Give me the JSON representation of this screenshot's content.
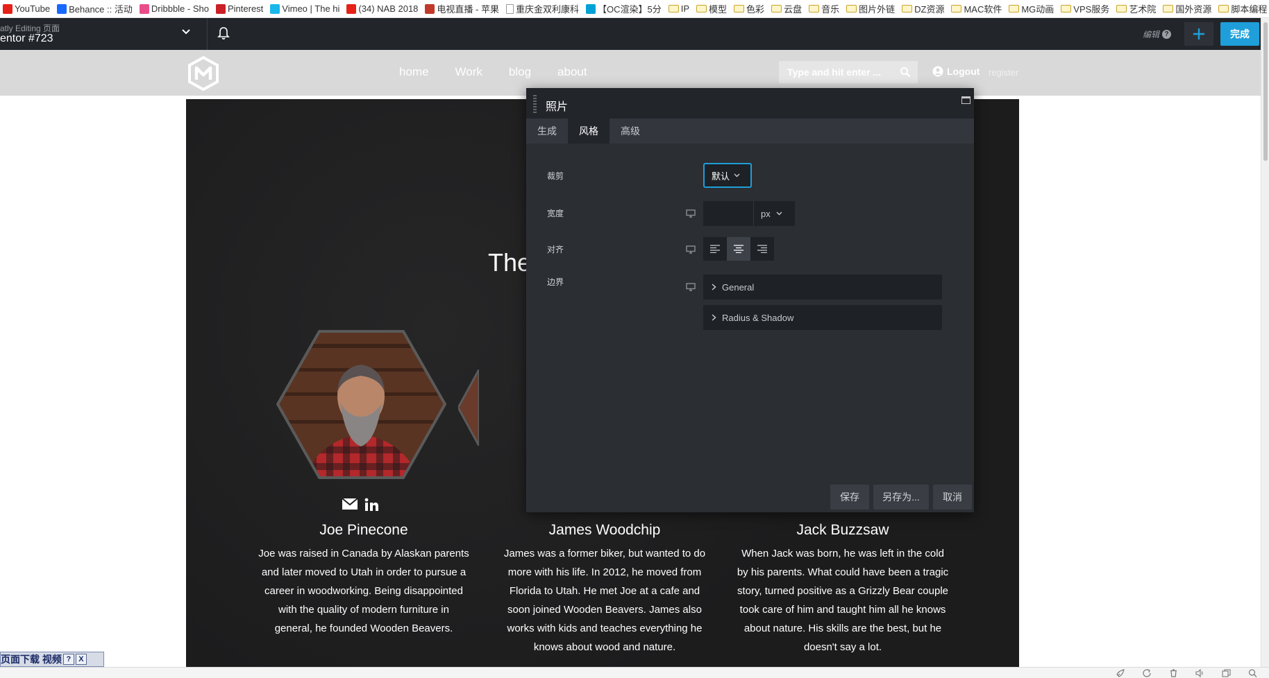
{
  "bookmarks": [
    {
      "label": "YouTube",
      "icon": "youtube-icon",
      "color": "#e62117"
    },
    {
      "label": "Behance :: 活动",
      "icon": "behance-icon",
      "color": "#1769ff"
    },
    {
      "label": "Dribbble - Sho",
      "icon": "dribbble-icon",
      "color": "#ea4c89"
    },
    {
      "label": "Pinterest",
      "icon": "pinterest-icon",
      "color": "#cb2027"
    },
    {
      "label": "Vimeo | The hi",
      "icon": "vimeo-icon",
      "color": "#1ab7ea"
    },
    {
      "label": "(34) NAB 2018",
      "icon": "youtube-icon",
      "color": "#e62117"
    },
    {
      "label": "电视直播 - 苹果",
      "icon": "tv-icon",
      "color": "#c0392b"
    },
    {
      "label": "重庆金双利康科",
      "icon": "page-icon",
      "color": "#999999"
    },
    {
      "label": "【OC渲染】5分",
      "icon": "bilibili-icon",
      "color": "#00a1d6"
    },
    {
      "label": "IP",
      "icon": "folder-icon",
      "color": "#c9a227"
    },
    {
      "label": "模型",
      "icon": "folder-icon",
      "color": "#c9a227"
    },
    {
      "label": "色彩",
      "icon": "folder-icon",
      "color": "#c9a227"
    },
    {
      "label": "云盘",
      "icon": "folder-icon",
      "color": "#c9a227"
    },
    {
      "label": "音乐",
      "icon": "folder-icon",
      "color": "#c9a227"
    },
    {
      "label": "图片外链",
      "icon": "folder-icon",
      "color": "#c9a227"
    },
    {
      "label": "DZ资源",
      "icon": "folder-icon",
      "color": "#c9a227"
    },
    {
      "label": "MAC软件",
      "icon": "folder-icon",
      "color": "#c9a227"
    },
    {
      "label": "MG动画",
      "icon": "folder-icon",
      "color": "#c9a227"
    },
    {
      "label": "VPS服务",
      "icon": "folder-icon",
      "color": "#c9a227"
    },
    {
      "label": "艺术院",
      "icon": "folder-icon",
      "color": "#c9a227"
    },
    {
      "label": "国外资源",
      "icon": "folder-icon",
      "color": "#c9a227"
    },
    {
      "label": "脚本编程",
      "icon": "folder-icon",
      "color": "#c9a227"
    }
  ],
  "bookmarks_more": "»",
  "topbar": {
    "subtitle": "atly Editing 页面",
    "title": "entor #723",
    "edit_label": "编辑",
    "help_glyph": "?",
    "done_label": "完成",
    "accent": "#1e9fd9"
  },
  "site": {
    "nav": [
      "home",
      "Work",
      "blog",
      "about"
    ],
    "search_placeholder": "Type and hit enter ...",
    "logout_label": "Logout",
    "register_label": "register"
  },
  "content": {
    "headline": "The",
    "team": [
      {
        "name": "Joe Pinecone",
        "bio": [
          "Joe was raised in Canada by Alaskan parents",
          "and later moved to Utah in order to pursue a",
          "career in woodworking. Being disappointed",
          "with the quality of modern furniture in",
          "general, he founded Wooden Beavers."
        ]
      },
      {
        "name": "James Woodchip",
        "bio": [
          "James was a former biker, but wanted to do",
          "more with his life. In 2012, he moved from",
          "Florida to Utah. He met Joe at a cafe and",
          "soon joined Wooden Beavers. James also",
          "works with kids and teaches everything he",
          "knows about wood and nature."
        ]
      },
      {
        "name": "Jack Buzzsaw",
        "bio": [
          "When Jack was born, he was left in the cold",
          "by his parents. What could have been a tragic",
          "story, turned positive as a Grizzly Bear couple",
          "took care of him and taught him all he knows",
          "about nature. His skills are the best, but he",
          "doesn't say a lot."
        ]
      }
    ]
  },
  "panel": {
    "title": "照片",
    "tabs": [
      {
        "label": "生成",
        "active": false
      },
      {
        "label": "风格",
        "active": true
      },
      {
        "label": "高级",
        "active": false
      }
    ],
    "crop_label": "裁剪",
    "crop_value": "默认",
    "width_label": "宽度",
    "width_value": "",
    "width_unit": "px",
    "align_label": "对齐",
    "align_selected": "center",
    "border_label": "边界",
    "accordions": [
      "General",
      "Radius & Shadow"
    ],
    "buttons": {
      "save": "保存",
      "save_as": "另存为...",
      "cancel": "取消"
    }
  },
  "download_bar": {
    "label": "页面下载 视频",
    "help": "?",
    "close": "X"
  }
}
